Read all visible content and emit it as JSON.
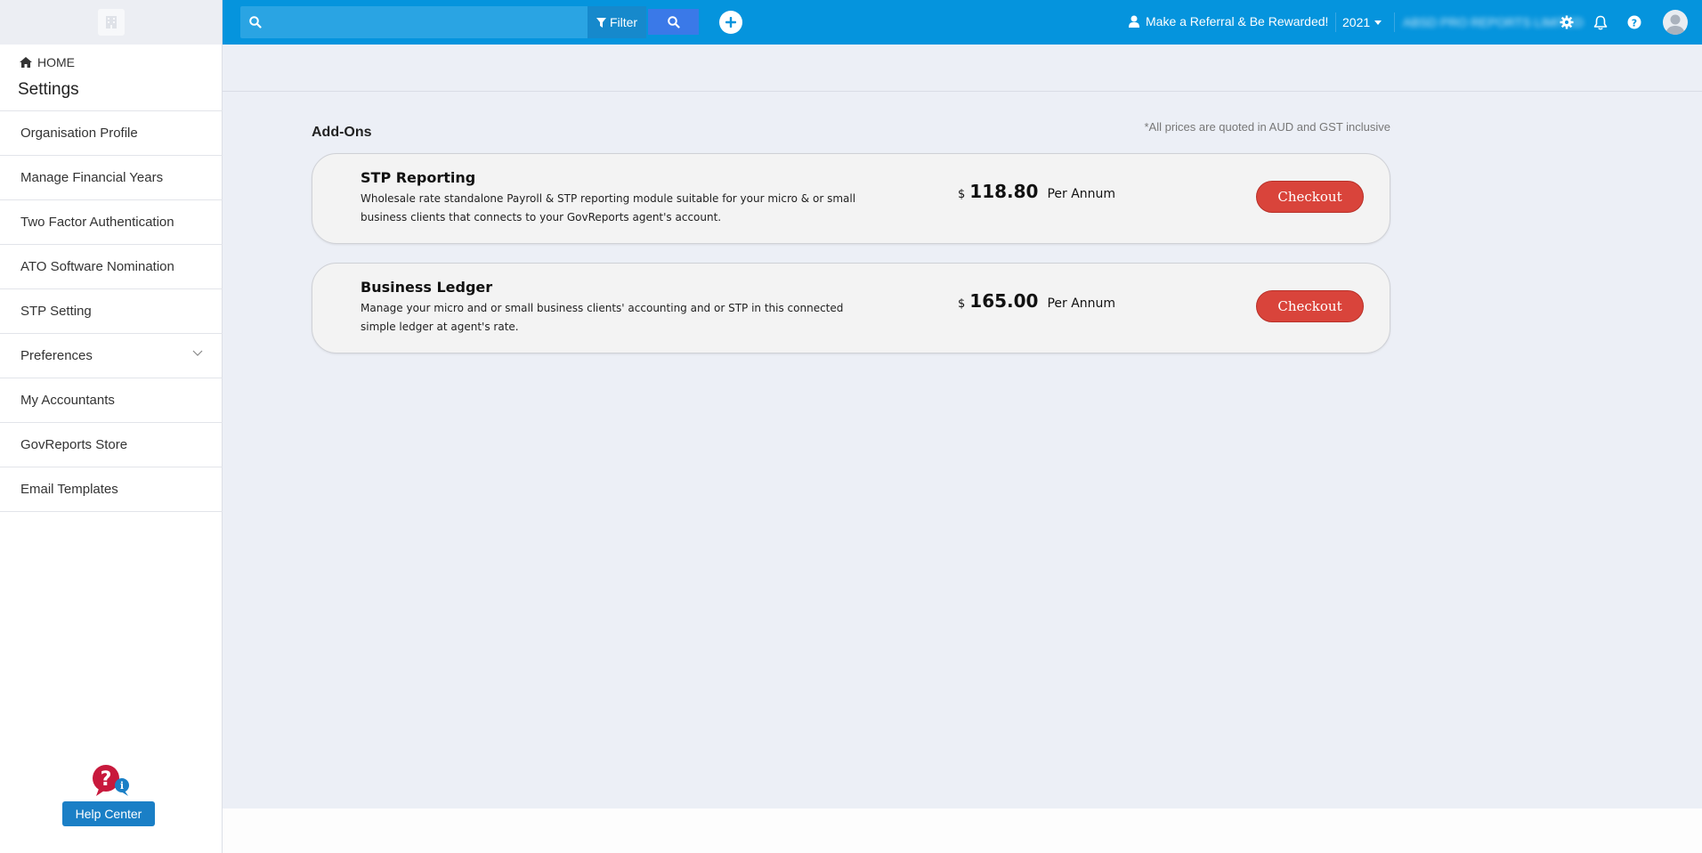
{
  "sidebar": {
    "home_label": "HOME",
    "title": "Settings",
    "items": [
      {
        "label": "Organisation Profile"
      },
      {
        "label": "Manage Financial Years"
      },
      {
        "label": "Two Factor Authentication"
      },
      {
        "label": "ATO Software Nomination"
      },
      {
        "label": "STP Setting"
      },
      {
        "label": "Preferences",
        "has_chevron": true
      },
      {
        "label": "My Accountants"
      },
      {
        "label": "GovReports Store"
      },
      {
        "label": "Email Templates"
      }
    ],
    "help_center_label": "Help Center"
  },
  "topbar": {
    "search": {
      "value": "",
      "placeholder": ""
    },
    "filter_label": "Filter",
    "referral_label": "Make a Referral & Be Rewarded!",
    "year": "2021",
    "organisation_name": "ABSD PRO REPORTS LIMITED"
  },
  "main": {
    "title": "Add-Ons",
    "price_note": "*All prices are quoted in AUD and GST inclusive",
    "addons": [
      {
        "name": "STP Reporting",
        "description": "Wholesale rate standalone Payroll & STP reporting module suitable for your micro & or small business clients that connects to your GovReports agent's account.",
        "currency": "$",
        "price": "118.80",
        "period": "Per Annum",
        "button_label": "Checkout"
      },
      {
        "name": "Business Ledger",
        "description": "Manage your micro and or small business clients' accounting and or STP in this connected simple ledger at agent's rate.",
        "currency": "$",
        "price": "165.00",
        "period": "Per Annum",
        "button_label": "Checkout"
      }
    ]
  },
  "colors": {
    "topbar": "#0594dd",
    "checkout": "#d9443b",
    "help_button": "#1a7fc6"
  }
}
